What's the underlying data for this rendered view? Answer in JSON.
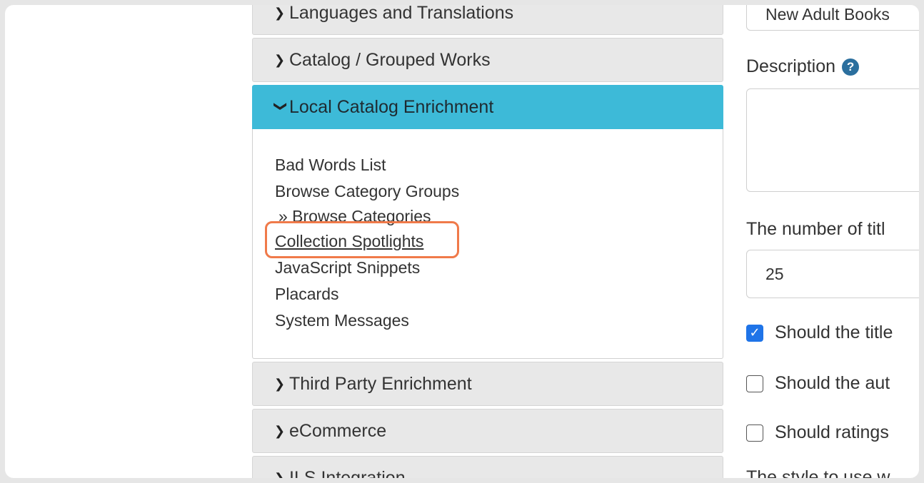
{
  "accordion": {
    "sections_top": [
      {
        "label": "Languages and Translations",
        "chevron": "chevron-right-icon"
      },
      {
        "label": "Catalog / Grouped Works",
        "chevron": "chevron-right-icon"
      }
    ],
    "active": {
      "label": "Local Catalog Enrichment",
      "chevron": "chevron-down-icon",
      "links": [
        "Bad Words List",
        "Browse Category Groups",
        "» Browse Categories",
        "Collection Spotlights",
        "JavaScript Snippets",
        "Placards",
        "System Messages"
      ]
    },
    "sections_bottom": [
      {
        "label": "Third Party Enrichment",
        "chevron": "chevron-right-icon"
      },
      {
        "label": "eCommerce",
        "chevron": "chevron-right-icon"
      },
      {
        "label": "ILS Integration",
        "chevron": "chevron-right-icon"
      }
    ],
    "active_color": "#3dbad8",
    "highlight_color": "#f07a4a"
  },
  "form": {
    "name_value": "New Adult Books",
    "description_label": "Description",
    "description_value": "",
    "num_titles_label": "The number of titl",
    "num_titles_value": "25",
    "checkboxes": [
      {
        "label": "Should the title",
        "checked": true
      },
      {
        "label": "Should the aut",
        "checked": false
      },
      {
        "label": "Should ratings",
        "checked": false
      }
    ],
    "style_label": "The style to use w"
  }
}
